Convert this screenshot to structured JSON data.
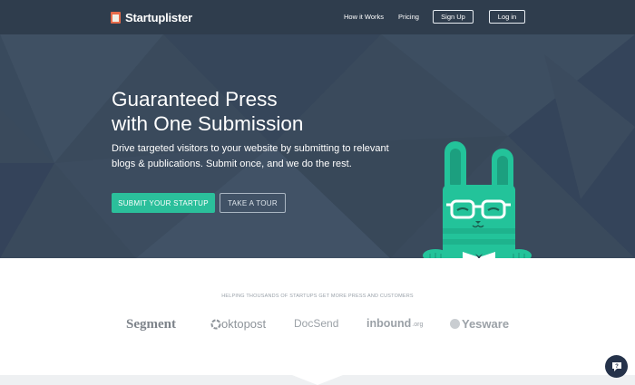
{
  "header": {
    "logo_text": "Startuplister",
    "nav": {
      "how_it_works": "How it Works",
      "pricing": "Pricing",
      "sign_up": "Sign Up",
      "log_in": "Log in"
    }
  },
  "hero": {
    "headline_line1": "Guaranteed Press",
    "headline_line2": "with One Submission",
    "subline_line1": "Drive targeted visitors to your website by submitting to relevant",
    "subline_line2": "blogs & publications. Submit once, and we do the rest.",
    "primary_cta": "SUBMIT YOUR STARTUP",
    "secondary_cta": "TAKE A TOUR"
  },
  "press": {
    "caption": "HELPING THOUSANDS OF STARTUPS GET MORE PRESS AND CUSTOMERS",
    "brands": {
      "segment": "Segment",
      "oktopost": "oktopost",
      "docsend": "DocSend",
      "inbound": "inbound",
      "inbound_tld": ".org",
      "yesware": "Yesware"
    }
  },
  "icons": {
    "chat": "chat-help-icon",
    "mascot": "bunny-mascot",
    "logo": "startuplister-logo-icon"
  },
  "colors": {
    "hero_bg": "#3a4a5c",
    "nav_bg": "#2f3d4d",
    "accent": "#2bbf9b",
    "chat_bg": "#25324a"
  }
}
